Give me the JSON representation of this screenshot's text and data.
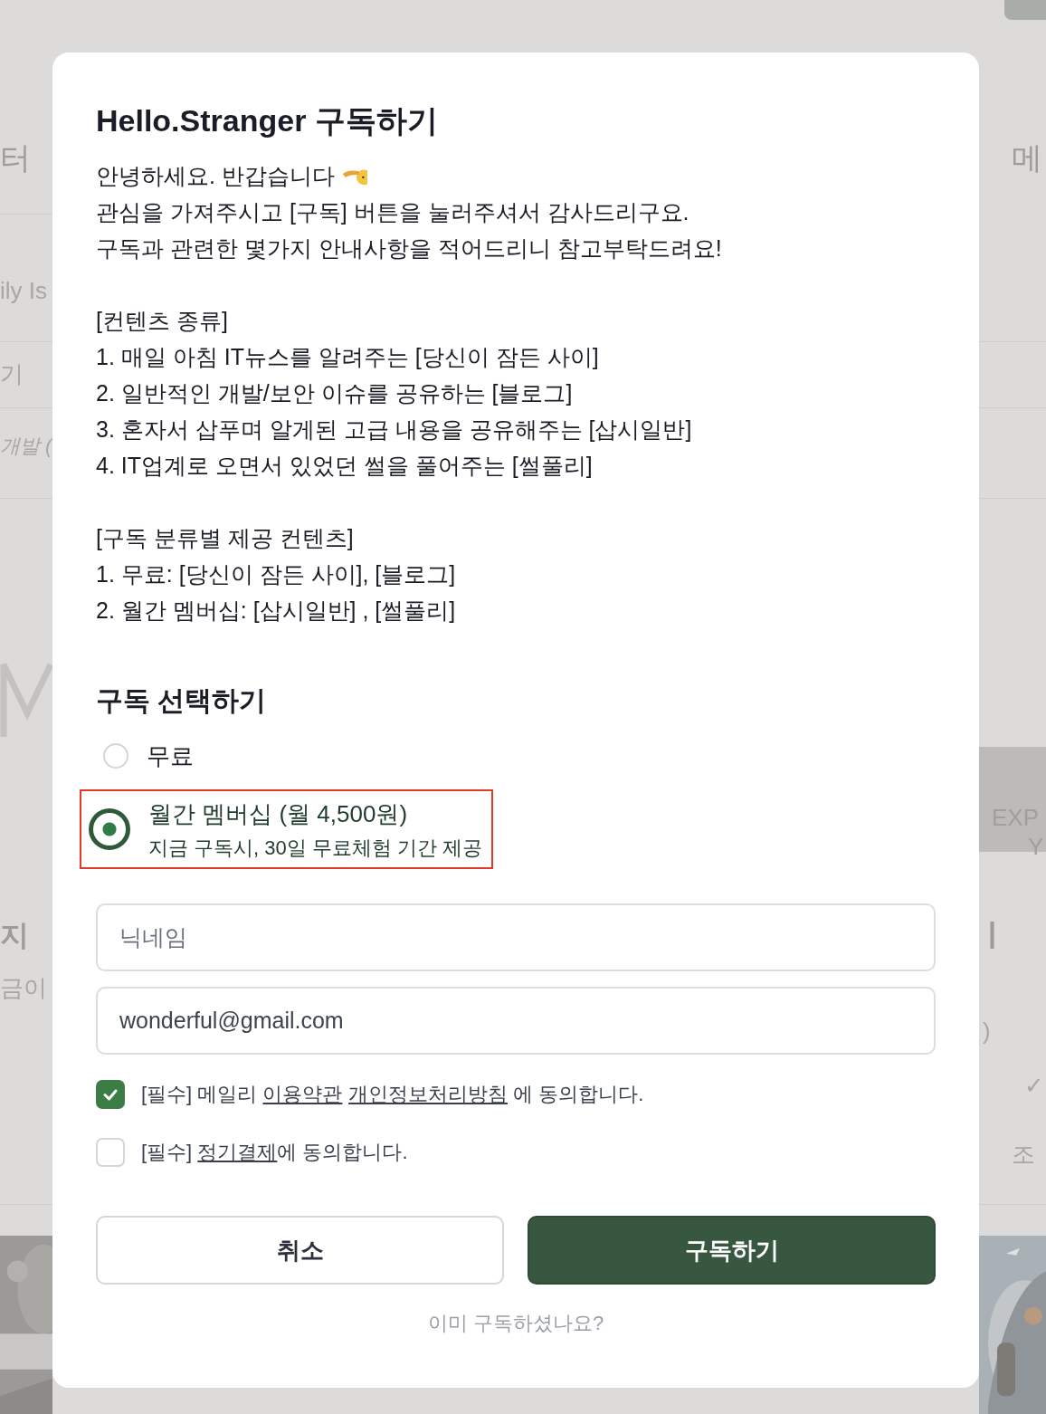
{
  "backdrop": {
    "left": [
      {
        "text": "터",
        "kind": "tab"
      },
      {
        "text": "ily Is",
        "kind": "item"
      },
      {
        "text": "기",
        "kind": "item"
      },
      {
        "text": "개발 (",
        "kind": "italic"
      },
      {
        "text": "지",
        "kind": "bold"
      },
      {
        "text": "금이",
        "kind": "item"
      }
    ],
    "right": [
      {
        "text": "메",
        "kind": "tab"
      },
      {
        "text": "EXP",
        "kind": "banner"
      },
      {
        "text": "Y",
        "kind": "banner"
      },
      {
        "text": "|",
        "kind": "bold"
      },
      {
        "text": ")",
        "kind": "item"
      },
      {
        "text": "✓",
        "kind": "item"
      },
      {
        "text": "조",
        "kind": "item"
      }
    ]
  },
  "modal": {
    "title": "Hello.Stranger 구독하기",
    "paragraphs": [
      [
        "안녕하세요. 반갑습니다",
        "관심을 가져주시고 [구독] 버튼을 눌러주셔서 감사드리구요.",
        "구독과 관련한 몇가지 안내사항을 적어드리니 참고부탁드려요!"
      ],
      [
        "[컨텐츠 종류]",
        "1. 매일 아침 IT뉴스를 알려주는 [당신이 잠든 사이]",
        "2. 일반적인 개발/보안 이슈를 공유하는 [블로그]",
        "3. 혼자서 삽푸며 알게된 고급 내용을 공유해주는 [삽시일반]",
        "4. IT업계로 오면서 있었던 썰을 풀어주는 [썰풀리]"
      ],
      [
        "[구독 분류별 제공 컨텐츠]",
        "1. 무료: [당신이 잠든 사이], [블로그]",
        "2. 월간 멤버십: [삽시일반] , [썰풀리]"
      ]
    ],
    "plan_heading": "구독 선택하기",
    "plans": [
      {
        "label": "무료",
        "selected": false,
        "highlighted": false
      },
      {
        "label": "월간 멤버십 (월 4,500원)",
        "note": "지금 구독시, 30일 무료체험 기간 제공",
        "selected": true,
        "highlighted": true
      }
    ],
    "fields": [
      {
        "placeholder": "닉네임"
      },
      {
        "value": "wonderful@gmail.com"
      }
    ],
    "agreements": [
      {
        "checked": true,
        "parts": [
          {
            "text": "[필수] 메일리 ",
            "link": false
          },
          {
            "text": "이용약관",
            "link": true
          },
          {
            "text": "개인정보처리방침",
            "link": true
          },
          {
            "text": " 에 동의합니다.",
            "link": false
          }
        ]
      },
      {
        "checked": false,
        "parts": [
          {
            "text": "[필수] ",
            "link": false
          },
          {
            "text": "정기결제",
            "link": true
          },
          {
            "text": "에 동의합니다.",
            "link": false
          }
        ]
      }
    ],
    "buttons": [
      {
        "label": "취소",
        "kind": "secondary"
      },
      {
        "label": "구독하기",
        "kind": "primary"
      }
    ],
    "footer_link": "이미 구독하셨나요?"
  }
}
